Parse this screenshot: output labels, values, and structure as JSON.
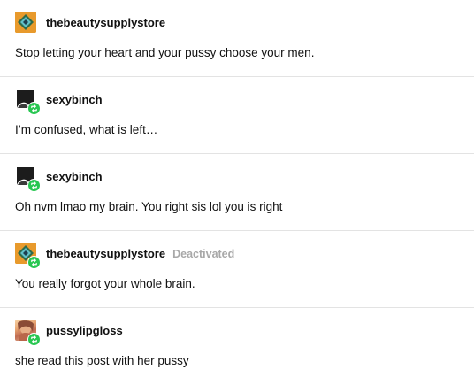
{
  "posts": [
    {
      "username": "thebeautysupplystore",
      "status": "",
      "avatar": "store-logo-avatar",
      "reblog": false,
      "text": "Stop letting your heart and your pussy choose your men."
    },
    {
      "username": "sexybinch",
      "status": "",
      "avatar": "dark-silhouette-avatar",
      "reblog": true,
      "text": "I’m confused, what is left…"
    },
    {
      "username": "sexybinch",
      "status": "",
      "avatar": "dark-silhouette-avatar",
      "reblog": true,
      "text": "Oh nvm lmao my brain. You right sis lol you is right"
    },
    {
      "username": "thebeautysupplystore",
      "status": "Deactivated",
      "avatar": "store-logo-avatar",
      "reblog": true,
      "text": "You really forgot your whole brain."
    },
    {
      "username": "pussylipgloss",
      "status": "",
      "avatar": "photo-avatar",
      "reblog": true,
      "text": "she read this post with her pussy"
    }
  ],
  "colors": {
    "reblog_badge": "#28c651",
    "store_avatar": "#e89a2c",
    "deactivated": "#a8a8a8",
    "divider": "#e3e3e3"
  }
}
